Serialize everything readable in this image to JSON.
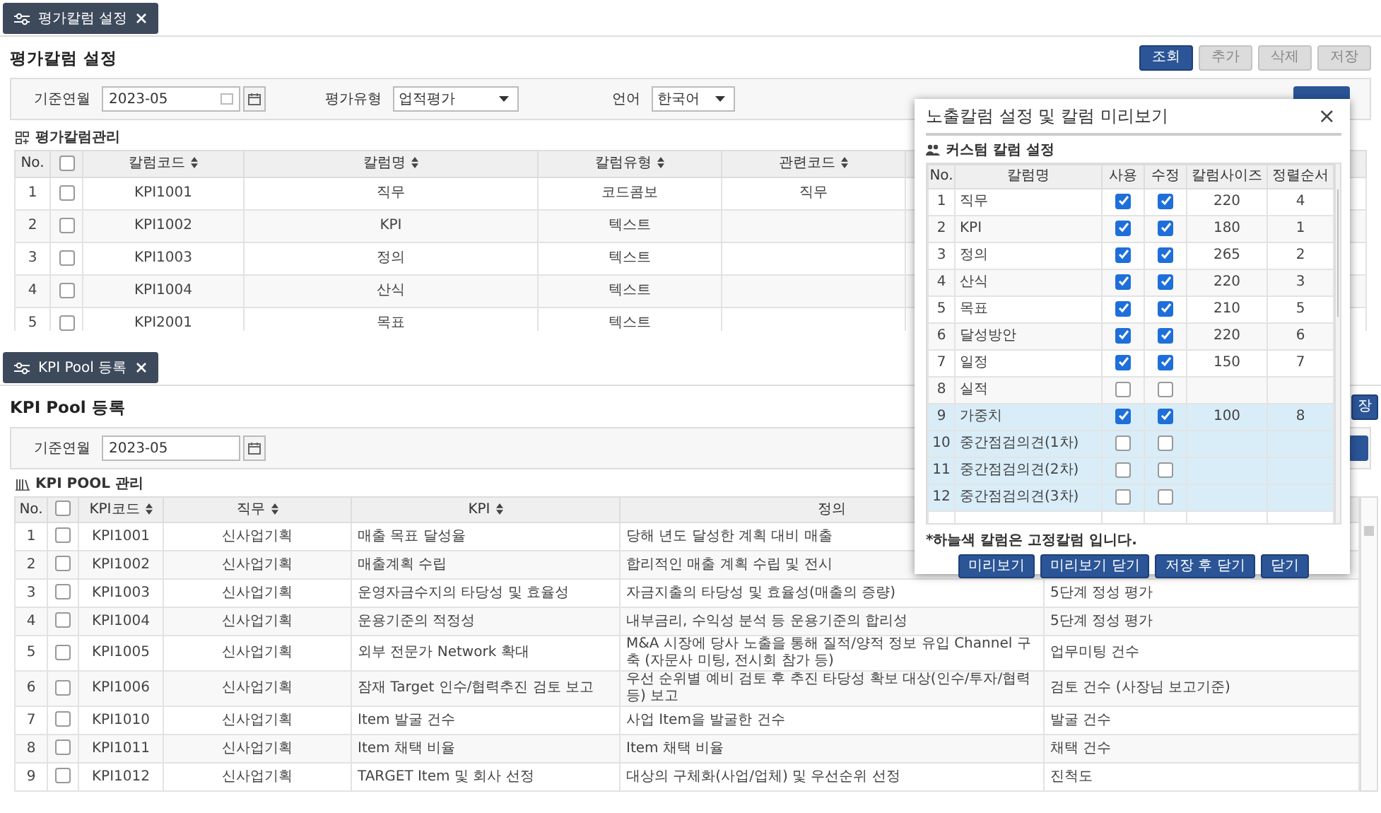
{
  "section1": {
    "tab": "평가칼럼 설정",
    "title": "평가칼럼 설정",
    "buttons": [
      {
        "label": "조회",
        "disabled": false
      },
      {
        "label": "추가",
        "disabled": true
      },
      {
        "label": "삭제",
        "disabled": true
      },
      {
        "label": "저장",
        "disabled": true
      }
    ],
    "filters": {
      "month_label": "기준연월",
      "month": "2023-05",
      "type_label": "평가유형",
      "type": "업적평가",
      "lang_label": "언어",
      "lang": "한국어"
    },
    "grid_title": "평가칼럼관리",
    "table": {
      "no_label": "No.",
      "all_checked": false,
      "columns": [
        {
          "label": "칼럼코드",
          "sortable": true
        },
        {
          "label": "칼럼명",
          "sortable": true
        },
        {
          "label": "칼럼유형",
          "sortable": true
        },
        {
          "label": "관련코드",
          "sortable": true
        }
      ],
      "rows": [
        {
          "no": "1",
          "checked": false,
          "cells": [
            "KPI1001",
            "직무",
            "코드콤보",
            "직무"
          ]
        },
        {
          "no": "2",
          "checked": false,
          "cells": [
            "KPI1002",
            "KPI",
            "텍스트"
          ]
        },
        {
          "no": "3",
          "checked": false,
          "cells": [
            "KPI1003",
            "정의",
            "텍스트"
          ]
        },
        {
          "no": "4",
          "checked": false,
          "cells": [
            "KPI1004",
            "산식",
            "텍스트"
          ]
        },
        {
          "no": "5",
          "checked": false,
          "cells": [
            "KPI2001",
            "목표",
            "텍스트"
          ]
        }
      ]
    }
  },
  "section2": {
    "tab": "KPI Pool 등록",
    "title": "KPI Pool 등록",
    "save_button": "장",
    "filters": {
      "month_label": "기준연월",
      "month": "2023-05"
    },
    "grid_title": "KPI POOL 관리",
    "table": {
      "no_label": "No.",
      "all_checked": false,
      "columns": [
        {
          "label": "KPI코드",
          "sortable": true
        },
        {
          "label": "직무",
          "sortable": true
        },
        {
          "label": "KPI",
          "sortable": true
        },
        {
          "label": "정의",
          "sortable": false
        }
      ],
      "rows": [
        {
          "no": "1",
          "checked": false,
          "cells": [
            "KPI1001",
            "신사업기획",
            "매출 목표 달성율",
            "당해 년도 달성한 계획 대비 매출"
          ]
        },
        {
          "no": "2",
          "checked": false,
          "cells": [
            "KPI1002",
            "신사업기획",
            "매출계획 수립",
            "합리적인 매출 계획 수립 및 전시"
          ]
        },
        {
          "no": "3",
          "checked": false,
          "cells": [
            "KPI1003",
            "신사업기획",
            "운영자금수지의 타당성 및 효율성",
            "자금지출의 타당성 및 효율성(매출의 증량)",
            "5단계 정성 평가"
          ]
        },
        {
          "no": "4",
          "checked": false,
          "cells": [
            "KPI1004",
            "신사업기획",
            "운용기준의 적정성",
            "내부금리, 수익성 분석 등 운용기준의 합리성",
            "5단계 정성 평가"
          ]
        },
        {
          "no": "5",
          "checked": false,
          "cells": [
            "KPI1005",
            "신사업기획",
            "외부 전문가 Network 확대",
            "M&A 시장에 당사 노출을 통해 질적/양적 정보 유입 Channel 구축 (자문사 미팅, 전시회 참가 등)",
            "업무미팅 건수"
          ]
        },
        {
          "no": "6",
          "checked": false,
          "cells": [
            "KPI1006",
            "신사업기획",
            "잠재 Target 인수/협력추진 검토 보고",
            "우선 순위별 예비 검토 후 추진 타당성 확보 대상(인수/투자/협력 등) 보고",
            "검토 건수 (사장님 보고기준)"
          ]
        },
        {
          "no": "7",
          "checked": false,
          "cells": [
            "KPI1010",
            "신사업기획",
            "Item 발굴 건수",
            "사업 Item을 발굴한 건수",
            "발굴 건수"
          ]
        },
        {
          "no": "8",
          "checked": false,
          "cells": [
            "KPI1011",
            "신사업기획",
            "Item 채택 비율",
            "Item 채택 비율",
            "채택 건수"
          ]
        },
        {
          "no": "9",
          "checked": false,
          "cells": [
            "KPI1012",
            "신사업기획",
            "TARGET Item 및 회사 선정",
            "대상의 구체화(사업/업체) 및 우선순위 선정",
            "진척도"
          ]
        }
      ]
    }
  },
  "dialog": {
    "title": "노출칼럼 설정 및 칼럼 미리보기",
    "close": "×",
    "subtitle": "커스텀 칼럼 설정",
    "columns": [
      "No.",
      "칼럼명",
      "사용",
      "수정",
      "칼럼사이즈",
      "정렬순서"
    ],
    "rows": [
      {
        "no": "1",
        "name": "직무",
        "use": true,
        "edit": true,
        "size": "220",
        "order": "4",
        "fixed": false
      },
      {
        "no": "2",
        "name": "KPI",
        "use": true,
        "edit": true,
        "size": "180",
        "order": "1",
        "fixed": false
      },
      {
        "no": "3",
        "name": "정의",
        "use": true,
        "edit": true,
        "size": "265",
        "order": "2",
        "fixed": false
      },
      {
        "no": "4",
        "name": "산식",
        "use": true,
        "edit": true,
        "size": "220",
        "order": "3",
        "fixed": false
      },
      {
        "no": "5",
        "name": "목표",
        "use": true,
        "edit": true,
        "size": "210",
        "order": "5",
        "fixed": false
      },
      {
        "no": "6",
        "name": "달성방안",
        "use": true,
        "edit": true,
        "size": "220",
        "order": "6",
        "fixed": false
      },
      {
        "no": "7",
        "name": "일정",
        "use": true,
        "edit": true,
        "size": "150",
        "order": "7",
        "fixed": false
      },
      {
        "no": "8",
        "name": "실적",
        "use": false,
        "edit": false,
        "fixed": false
      },
      {
        "no": "9",
        "name": "가중치",
        "use": true,
        "edit": true,
        "size": "100",
        "order": "8",
        "fixed": true
      },
      {
        "no": "10",
        "name": "중간점검의견(1차)",
        "use": false,
        "edit": false,
        "fixed": true
      },
      {
        "no": "11",
        "name": "중간점검의견(2차)",
        "use": false,
        "edit": false,
        "fixed": true
      },
      {
        "no": "12",
        "name": "중간점검의견(3차)",
        "use": false,
        "edit": false,
        "fixed": true
      }
    ],
    "note": "*하늘색 칼럼은 고정칼럼 입니다.",
    "buttons": [
      "미리보기",
      "미리보기 닫기",
      "저장 후 닫기",
      "닫기"
    ]
  }
}
